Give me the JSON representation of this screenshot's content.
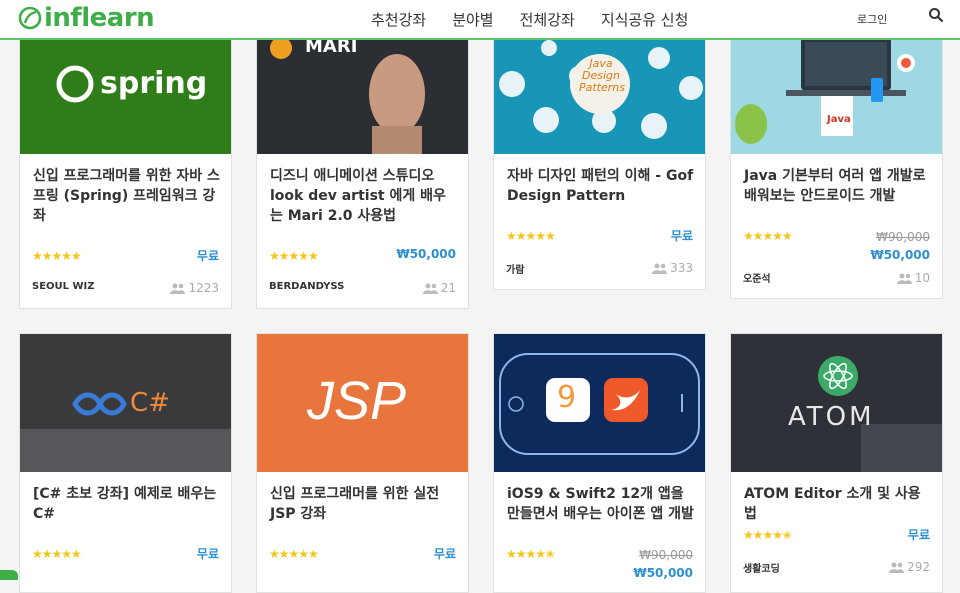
{
  "header": {
    "logo": "inflearn",
    "nav": [
      "추천강좌",
      "분야별",
      "전체강좌",
      "지식공유 신청"
    ],
    "login": "로그인"
  },
  "courses": [
    {
      "title": "신입 프로그래머를 위한 자바 스프링 (Spring) 프레임워크 강좌",
      "rating": 5,
      "price": "무료",
      "old_price": "",
      "author": "SEOUL WIZ",
      "students": "1223",
      "thumb_text": "spring"
    },
    {
      "title": "디즈니 애니메이션 스튜디오 look dev artist 에게 배우는 Mari 2.0 사용법",
      "rating": 5,
      "price": "₩50,000",
      "old_price": "",
      "author": "BERDANDYSS",
      "students": "21",
      "thumb_text": "MARI"
    },
    {
      "title": "자바 디자인 패턴의 이해 - Gof Design Pattern",
      "rating": 5,
      "price": "무료",
      "old_price": "",
      "author": "가람",
      "students": "333",
      "thumb_text": "Java Design Patterns"
    },
    {
      "title": "Java 기본부터 여러 앱 개발로 배워보는 안드로이드 개발",
      "rating": 5,
      "price": "₩50,000",
      "old_price": "₩90,000",
      "author": "오준석",
      "students": "10",
      "thumb_text": "Java"
    },
    {
      "title": "[C# 초보 강좌] 예제로 배우는 C#",
      "rating": 5,
      "price": "무료",
      "old_price": "",
      "author": "",
      "students": "",
      "thumb_text": "C#"
    },
    {
      "title": "신입 프로그래머를 위한 실전 JSP 강좌",
      "rating": 5,
      "price": "무료",
      "old_price": "",
      "author": "",
      "students": "",
      "thumb_text": "JSP"
    },
    {
      "title": "iOS9 & Swift2 12개 앱을 만들면서 배우는 아이폰 앱 개발",
      "rating": 4.5,
      "price": "₩50,000",
      "old_price": "₩90,000",
      "author": "",
      "students": "",
      "thumb_text": "9"
    },
    {
      "title": "ATOM Editor 소개 및 사용법",
      "rating": 4.5,
      "price": "무료",
      "old_price": "",
      "author": "생활코딩",
      "students": "292",
      "thumb_text": "ATOM"
    }
  ],
  "colors": {
    "brand": "#3fae49",
    "price": "#2e8fd1",
    "star": "#f5c518"
  }
}
